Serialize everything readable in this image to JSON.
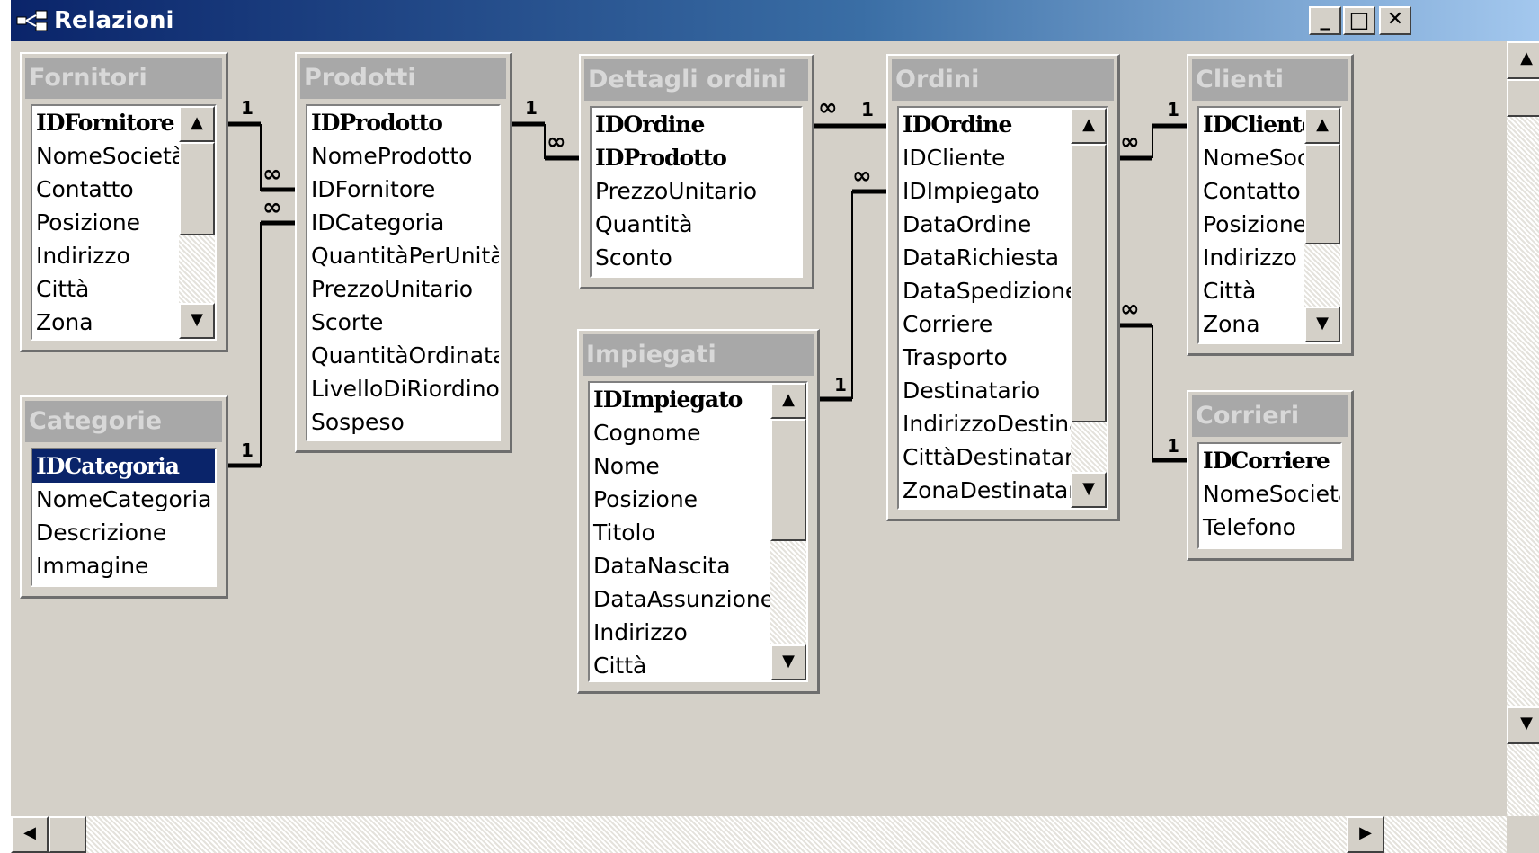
{
  "window": {
    "title": "Relazioni",
    "buttons": {
      "minimize": "_",
      "maximize": "□",
      "close": "✕"
    }
  },
  "tables": {
    "fornitori": {
      "title": "Fornitori",
      "fields": [
        "IDFornitore",
        "NomeSocietà",
        "Contatto",
        "Posizione",
        "Indirizzo",
        "Città",
        "Zona"
      ]
    },
    "categorie": {
      "title": "Categorie",
      "fields": [
        "IDCategoria",
        "NomeCategoria",
        "Descrizione",
        "Immagine"
      ]
    },
    "prodotti": {
      "title": "Prodotti",
      "fields": [
        "IDProdotto",
        "NomeProdotto",
        "IDFornitore",
        "IDCategoria",
        "QuantitàPerUnità",
        "PrezzoUnitario",
        "Scorte",
        "QuantitàOrdinata",
        "LivelloDiRiordino",
        "Sospeso"
      ]
    },
    "dettagli_ordini": {
      "title": "Dettagli ordini",
      "fields": [
        "IDOrdine",
        "IDProdotto",
        "PrezzoUnitario",
        "Quantità",
        "Sconto"
      ]
    },
    "impiegati": {
      "title": "Impiegati",
      "fields": [
        "IDImpiegato",
        "Cognome",
        "Nome",
        "Posizione",
        "Titolo",
        "DataNascita",
        "DataAssunzione",
        "Indirizzo",
        "Città"
      ]
    },
    "ordini": {
      "title": "Ordini",
      "fields": [
        "IDOrdine",
        "IDCliente",
        "IDImpiegato",
        "DataOrdine",
        "DataRichiesta",
        "DataSpedizione",
        "Corriere",
        "Trasporto",
        "Destinatario",
        "IndirizzoDestina",
        "CittàDestinatari",
        "ZonaDestinatari"
      ]
    },
    "clienti": {
      "title": "Clienti",
      "fields": [
        "IDCliente",
        "NomeSoci",
        "Contatto",
        "Posizione",
        "Indirizzo",
        "Città",
        "Zona"
      ]
    },
    "corrieri": {
      "title": "Corrieri",
      "fields": [
        "IDCorriere",
        "NomeSocietà",
        "Telefono"
      ]
    }
  },
  "markers": {
    "one": "1",
    "many": "∞"
  },
  "icons": {
    "scroll_up": "scroll-up-arrow-icon",
    "scroll_down": "scroll-down-arrow-icon",
    "scroll_left": "scroll-left-arrow-icon",
    "scroll_right": "scroll-right-arrow-icon",
    "relationships": "relationships-icon"
  }
}
